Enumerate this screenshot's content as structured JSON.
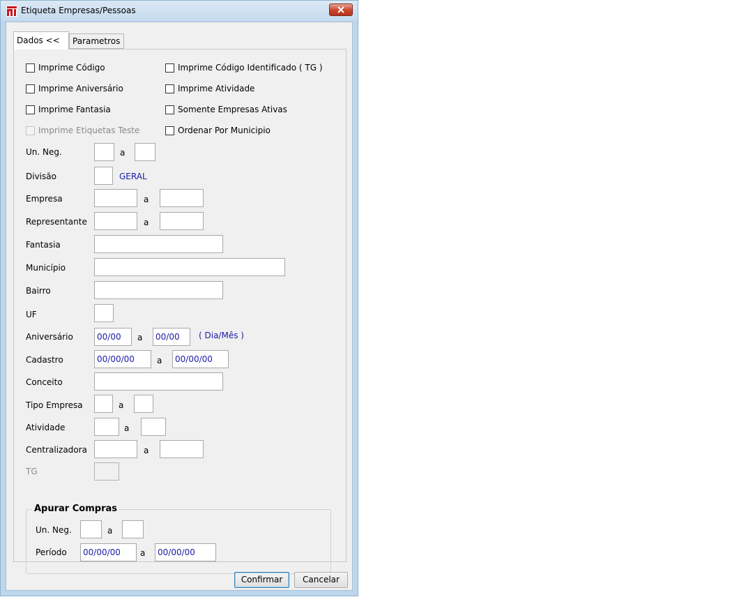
{
  "window": {
    "title": "Etiqueta Empresas/Pessoas",
    "icon": "app-logo-icon",
    "close_icon": "close-icon"
  },
  "tabs": [
    {
      "label": "Dados <<",
      "active": true
    },
    {
      "label": "Parametros",
      "active": false
    }
  ],
  "checkboxes": {
    "imprime_codigo": "Imprime Código",
    "imprime_codigo_tg": "Imprime Código Identificado ( TG )",
    "imprime_aniversario": "Imprime Aniversário",
    "imprime_atividade": "Imprime Atividade",
    "imprime_fantasia": "Imprime Fantasia",
    "somente_ativas": "Somente Empresas Ativas",
    "imprime_teste": "Imprime Etiquetas Teste",
    "ordenar_municipio": "Ordenar Por Municipio"
  },
  "fields": {
    "un_neg": "Un. Neg.",
    "divisao": "Divisão",
    "divisao_value": "GERAL",
    "empresa": "Empresa",
    "representante": "Representante",
    "fantasia": "Fantasia",
    "municipio": "Município",
    "bairro": "Bairro",
    "uf": "UF",
    "aniversario": "Aniversário",
    "aniversario_de": "00/00",
    "aniversario_ate": "00/00",
    "aniversario_hint": "( Dia/Mês )",
    "cadastro": "Cadastro",
    "cadastro_de": "00/00/00",
    "cadastro_ate": "00/00/00",
    "conceito": "Conceito",
    "tipo_empresa": "Tipo Empresa",
    "atividade": "Atividade",
    "centralizadora": "Centralizadora",
    "tg": "TG",
    "range_sep": "a"
  },
  "apurar_compras": {
    "title": "Apurar Compras",
    "un_neg": "Un. Neg.",
    "periodo": "Período",
    "periodo_de": "00/00/00",
    "periodo_ate": "00/00/00"
  },
  "buttons": {
    "confirmar": "Confirmar",
    "cancelar": "Cancelar"
  },
  "colors": {
    "value_text": "#1a1aa6",
    "title_bar": "#c5dbee",
    "close_button": "#c7442b"
  }
}
